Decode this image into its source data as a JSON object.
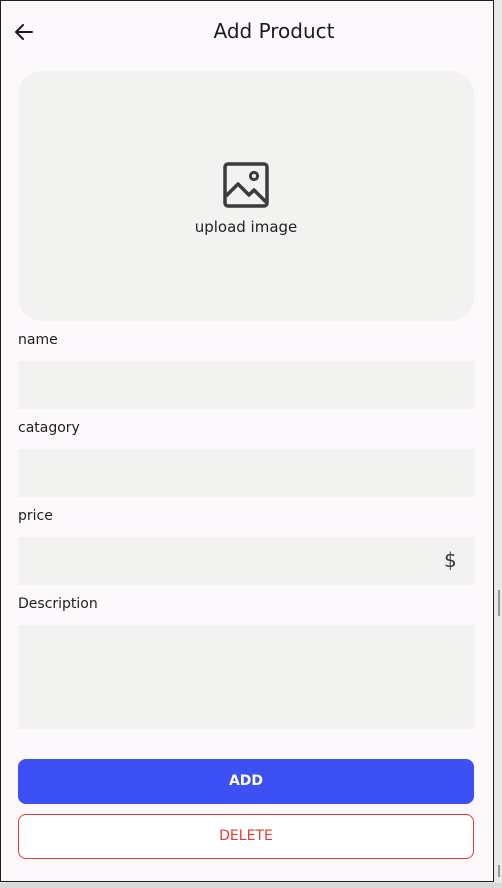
{
  "header": {
    "title": "Add Product",
    "back_icon": "arrow-left-icon"
  },
  "upload": {
    "label": "upload image",
    "icon": "image-icon"
  },
  "form": {
    "name": {
      "label": "name",
      "value": "",
      "placeholder": ""
    },
    "category": {
      "label": "catagory",
      "value": "",
      "placeholder": ""
    },
    "price": {
      "label": "price",
      "value": "",
      "placeholder": "",
      "suffix": "$"
    },
    "description": {
      "label": "Description",
      "value": "",
      "placeholder": ""
    }
  },
  "actions": {
    "add_label": "ADD",
    "delete_label": "DELETE"
  },
  "colors": {
    "accent": "#3d50f5",
    "danger": "#e53935",
    "field_bg": "#f2f2f1",
    "page_bg": "#fdf8fc"
  }
}
